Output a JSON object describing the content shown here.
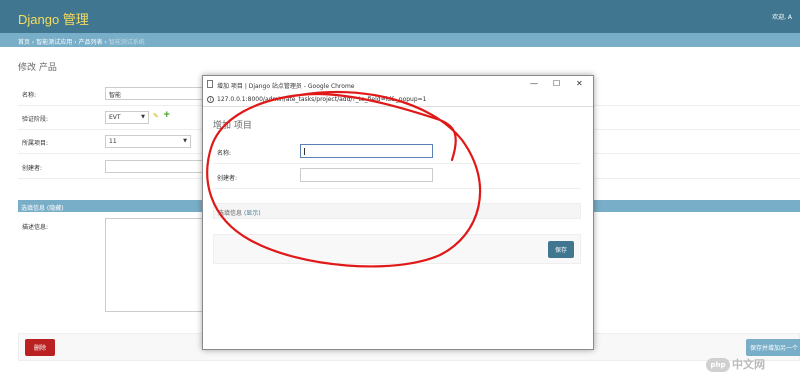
{
  "header": {
    "brand": "Django 管理",
    "user_tools": "欢迎, A"
  },
  "breadcrumbs": {
    "home": "首页",
    "app": "智能测试应用",
    "model": "产品列表",
    "current": "智能测试系统"
  },
  "page_title": "修改 产品",
  "form": {
    "name_label": "名称:",
    "name_value": "智能",
    "stage_label": "验证阶段:",
    "stage_value": "EVT",
    "project_label": "所属项目:",
    "project_value": "11",
    "creator_label": "创建者:"
  },
  "optional_fieldset": {
    "title": "选填信息 (隐藏)",
    "desc_label": "描述信息:"
  },
  "footer": {
    "delete_label": "删除",
    "save_add_label": "保存并增加另一个"
  },
  "popup": {
    "window_title": "增加 项目 | Django 站点管理员 - Google Chrome",
    "url": "127.0.0.1:8000/admin/ate_tasks/project/add/?_to_field=id&_popup=1",
    "heading": "增加 项目",
    "name_label": "名称:",
    "creator_label": "创建者:",
    "optional_label": "选填信息",
    "show_label": "(显示)",
    "save_label": "保存",
    "controls": {
      "minimize": "—",
      "maximize": "☐",
      "close": "✕"
    }
  },
  "watermark": {
    "logo": "php",
    "text": "中文网"
  },
  "colors": {
    "header": "#417690",
    "breadcrumbs": "#79aec8",
    "brand": "#f5dd5d",
    "delete": "#ba2121",
    "annotation": "#e01818"
  }
}
